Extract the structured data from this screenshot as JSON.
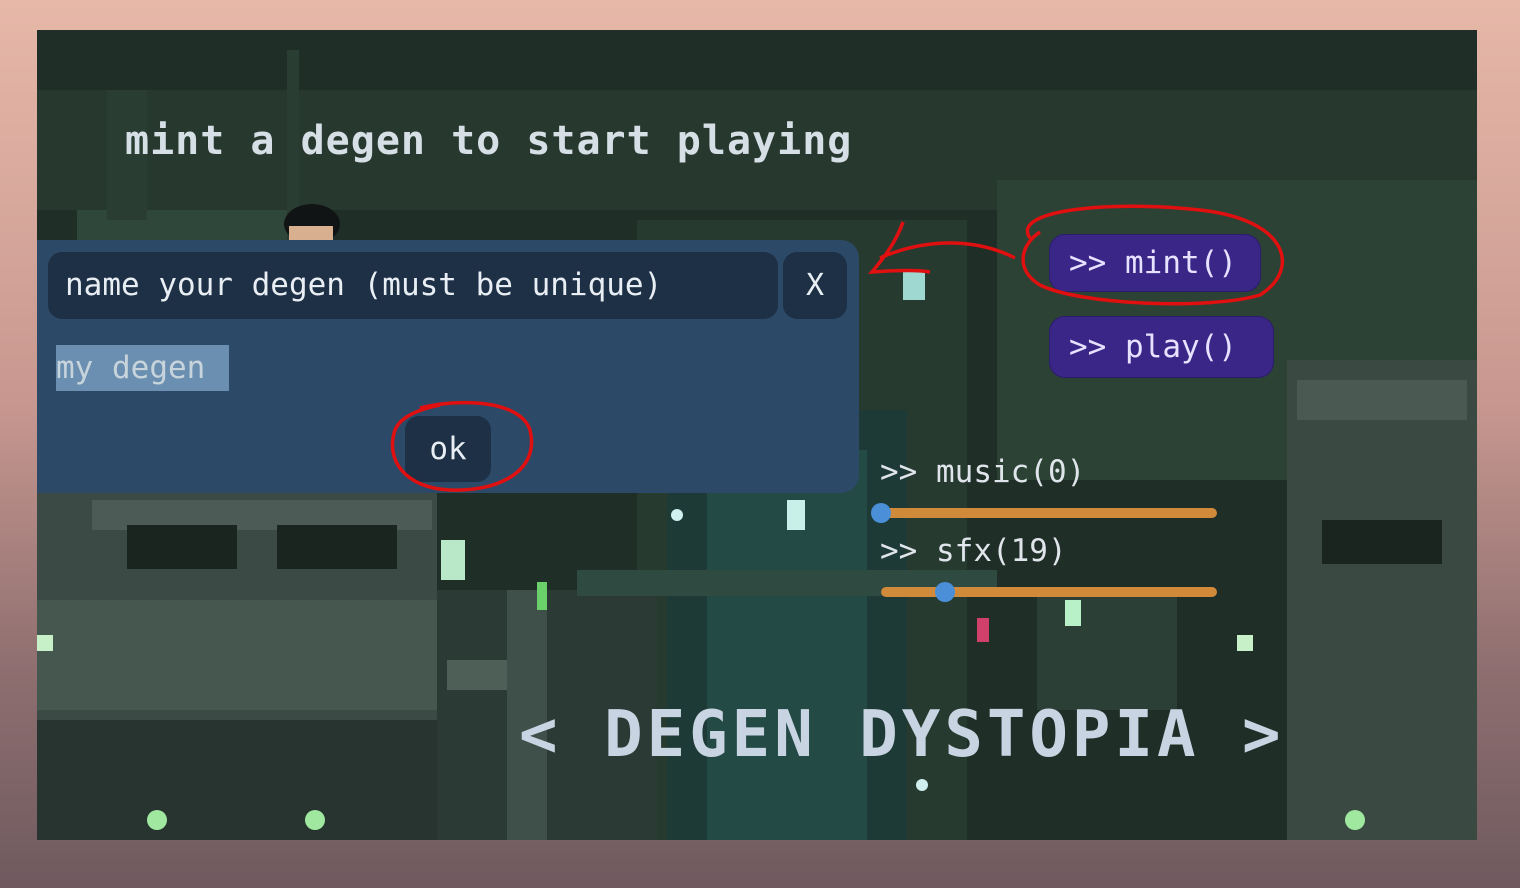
{
  "headline": "mint a degen to start playing",
  "buttons": {
    "mint_label": ">> mint()",
    "play_label": ">> play()"
  },
  "audio": {
    "music_label": ">> music(0)",
    "music_value": 0,
    "sfx_label": ">> sfx(19)",
    "sfx_value": 19,
    "max": 100
  },
  "dialog": {
    "title": "name your degen (must be unique)",
    "close_label": "X",
    "input_value": "my degen",
    "ok_label": "ok"
  },
  "logo_text": "< DEGEN DYSTOPIA >",
  "colors": {
    "accent_button": "#3a2687",
    "dialog_bg": "#2c4a68",
    "slider_track": "#d08a3a",
    "slider_thumb": "#4a8fd8",
    "annotation": "#e01010"
  }
}
